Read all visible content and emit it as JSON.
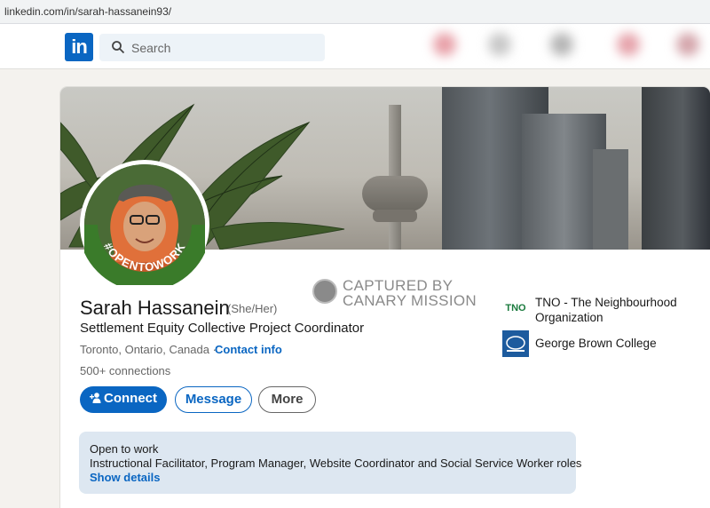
{
  "browser": {
    "url": "linkedin.com/in/sarah-hassanein93/"
  },
  "nav": {
    "logo_text": "in",
    "search_placeholder": "Search"
  },
  "watermark": {
    "line1": "CAPTURED BY",
    "line2": "CANARY MISSION"
  },
  "profile": {
    "name": "Sarah Hassanein",
    "pronouns": "(She/Her)",
    "headline": "Settlement Equity Collective Project Coordinator",
    "location": "Toronto, Ontario, Canada ·",
    "contact_info": "Contact info",
    "connections": "500+ connections",
    "avatar_badge": "#OPENTOWORK"
  },
  "actions": {
    "connect": "Connect",
    "message": "Message",
    "more": "More"
  },
  "organizations": [
    {
      "name": "TNO - The Neighbourhood Organization",
      "logo": "TNO"
    },
    {
      "name": "George Brown College",
      "logo": "gbc-logo"
    }
  ],
  "open_to_work": {
    "title": "Open to work",
    "roles": "Instructional Facilitator, Program Manager, Website Coordinator and Social Service Worker roles",
    "link": "Show details"
  },
  "colors": {
    "brand": "#0a66c2",
    "open_to_work_green": "#3a7b2a"
  }
}
